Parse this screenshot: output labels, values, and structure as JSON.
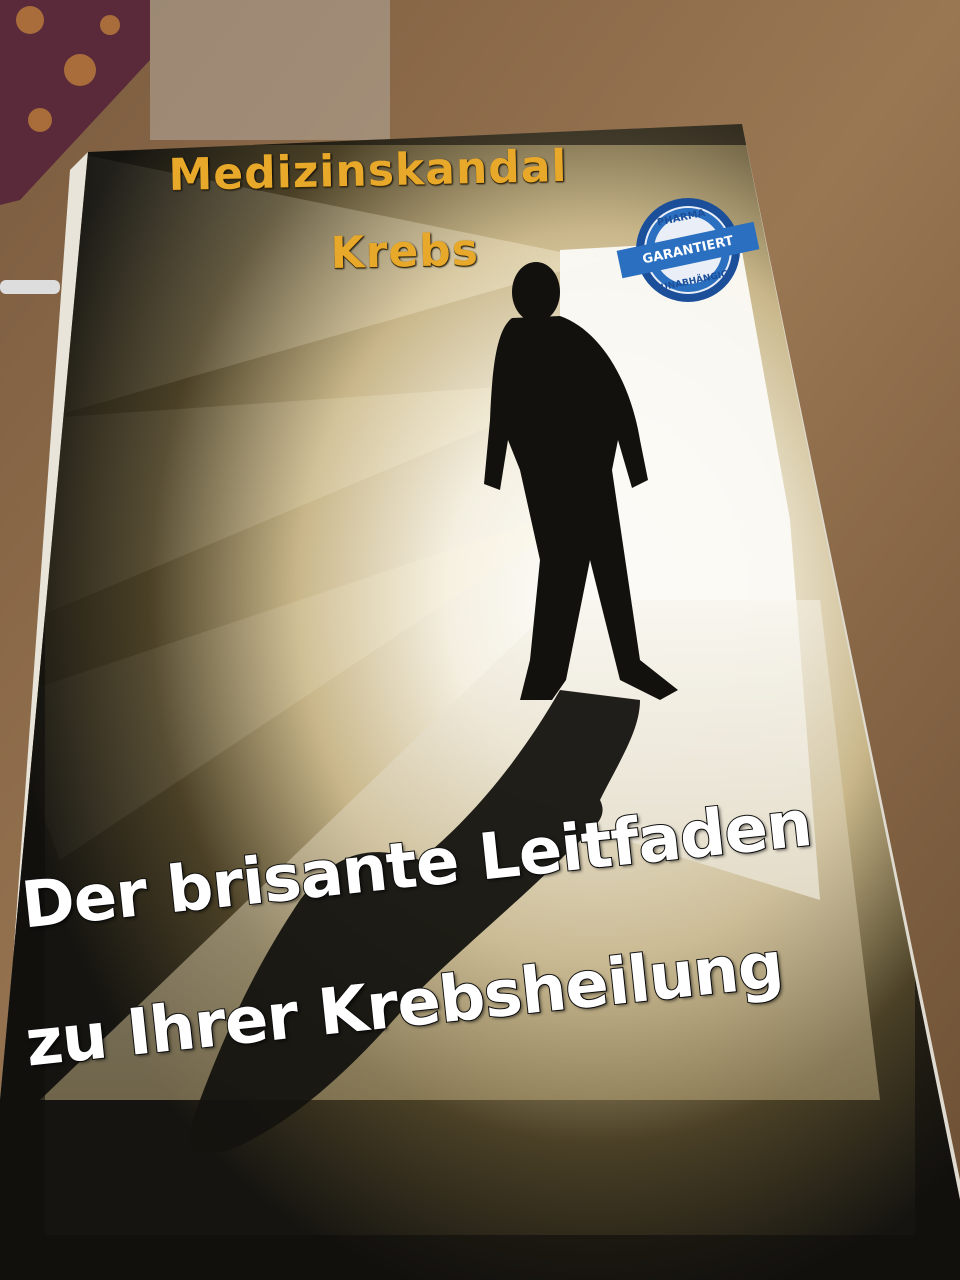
{
  "book": {
    "title_line1": "Medizinskandal",
    "title_line2": "Krebs",
    "subtitle_line1": "Der brisante Leitfaden",
    "subtitle_line2": "zu Ihrer Krebsheilung"
  },
  "seal": {
    "top_text": "PHARMA",
    "banner_text": "GARANTIERT",
    "bottom_text": "UNABHÄNGIG"
  },
  "colors": {
    "title": "#e8a82a",
    "subtitle": "#ffffff",
    "seal_blue": "#2a6fc0",
    "cover_dark": "#141410",
    "table_wood": "#8a6a4a"
  },
  "icons": [
    "silhouette-figure",
    "pharma-seal"
  ]
}
